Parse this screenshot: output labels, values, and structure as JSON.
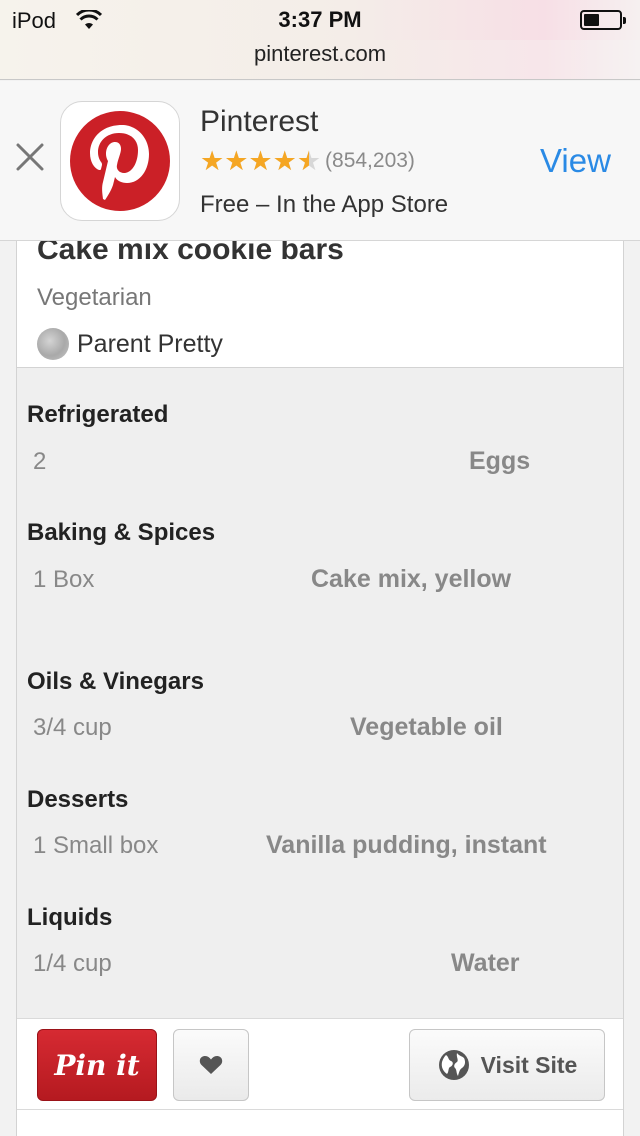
{
  "status_bar": {
    "carrier": "iPod",
    "time": "3:37 PM",
    "battery_level": 0.45
  },
  "browser": {
    "url": "pinterest.com"
  },
  "app_banner": {
    "app_name": "Pinterest",
    "rating_stars": 4.5,
    "rating_count": "(854,203)",
    "subtitle": "Free – In the App Store",
    "view_label": "View",
    "star_color": "#f5a623",
    "brand_color": "#cb2027",
    "link_color": "#2a8ae5"
  },
  "recipe": {
    "title": "Cake mix cookie bars",
    "tag": "Vegetarian",
    "source": "Parent Pretty"
  },
  "ingredients": [
    {
      "section": "Refrigerated",
      "quantity": "2",
      "name": "Eggs"
    },
    {
      "section": "Baking & Spices",
      "quantity": "1 Box",
      "name": "Cake mix, yellow"
    },
    {
      "section": "Oils & Vinegars",
      "quantity": "3/4 cup",
      "name": "Vegetable oil"
    },
    {
      "section": "Desserts",
      "quantity": "1 Small box",
      "name": "Vanilla pudding, instant"
    },
    {
      "section": "Liquids",
      "quantity": "1/4 cup",
      "name": "Water"
    }
  ],
  "actions": {
    "pin_label": "Pin it",
    "visit_label": "Visit Site"
  }
}
